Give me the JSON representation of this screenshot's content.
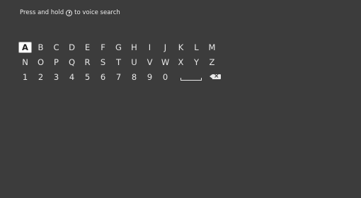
{
  "hint": {
    "prefix": "Press and hold",
    "icon": "microphone-icon",
    "suffix": "to voice search"
  },
  "keyboard": {
    "focused_key": "A",
    "row1": [
      "A",
      "B",
      "C",
      "D",
      "E",
      "F",
      "G",
      "H",
      "I",
      "J",
      "K",
      "L",
      "M"
    ],
    "row2": [
      "N",
      "O",
      "P",
      "Q",
      "R",
      "S",
      "T",
      "U",
      "V",
      "W",
      "X",
      "Y",
      "Z"
    ],
    "row3": [
      "1",
      "2",
      "3",
      "4",
      "5",
      "6",
      "7",
      "8",
      "9",
      "0"
    ],
    "space_icon": "space-bar-icon",
    "backspace_icon": "backspace-icon"
  }
}
